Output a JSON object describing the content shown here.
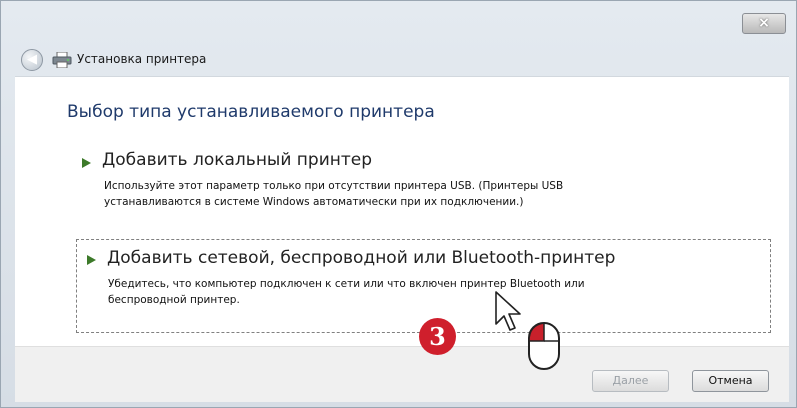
{
  "window": {
    "close_label": "×",
    "title": "Установка принтера",
    "back_icon": "back-arrow-icon",
    "title_icon": "printer-icon"
  },
  "content": {
    "heading": "Выбор типа устанавливаемого принтера",
    "options": [
      {
        "title": "Добавить локальный принтер",
        "desc_line1": "Используйте этот параметр только при отсутствии принтера USB. (Принтеры USB",
        "desc_line2": "устанавливаются в системе Windows автоматически при их подключении.)"
      },
      {
        "title": "Добавить сетевой, беспроводной или Bluetooth-принтер",
        "desc_line1": "Убедитесь, что компьютер подключен к сети или что включен принтер Bluetooth или",
        "desc_line2": "беспроводной принтер."
      }
    ]
  },
  "annotation": {
    "step_number": "3",
    "icons": [
      "cursor-arrow-icon",
      "mouse-icon"
    ]
  },
  "footer": {
    "next_label": "Далее",
    "cancel_label": "Отмена"
  },
  "colors": {
    "heading": "#1f3a6b",
    "badge": "#cf1f2c",
    "arrow": "#3d7a2a"
  }
}
